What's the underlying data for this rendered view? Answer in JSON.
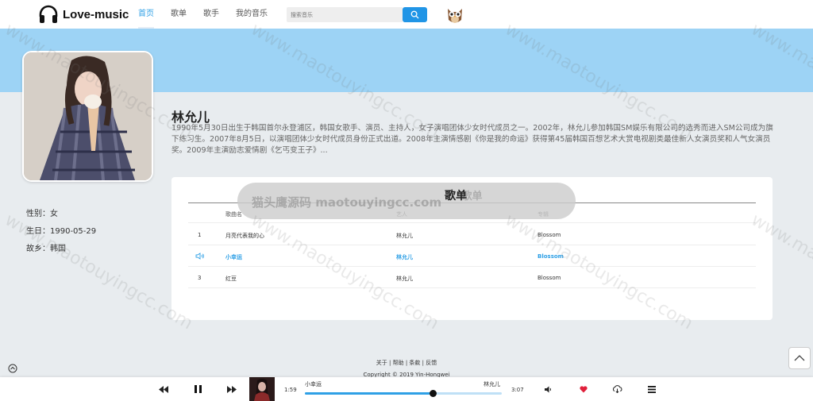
{
  "app": {
    "logo_text": "Love-music"
  },
  "nav": {
    "items": [
      "首页",
      "歌单",
      "歌手",
      "我的音乐"
    ],
    "active_index": 0
  },
  "search": {
    "placeholder": "搜索音乐"
  },
  "artist": {
    "name": "林允儿",
    "description": "1990年5月30日出生于韩国首尔永登浦区，韩国女歌手、演员、主持人，女子演唱团体少女时代成员之一。2002年，林允儿参加韩国SM娱乐有限公司的选秀而进入SM公司成为旗下练习生。2007年8月5日，以演唱团体少女时代成员身份正式出道。2008年主演情感剧《你是我的命运》获得第45届韩国百想艺术大赏电视剧类最佳新人女演员奖和人气女演员奖。2009年主演励志爱情剧《乞丐变王子》...",
    "gender": "性别：女",
    "birthday": "生日：1990-05-29",
    "hometown": "故乡：韩国"
  },
  "songlist": {
    "title": "歌单",
    "headers": {
      "name": "歌曲名",
      "artist": "艺人",
      "album": "专辑"
    },
    "rows": [
      {
        "index": "1",
        "name": "月亮代表我的心",
        "artist": "林允儿",
        "album": "Blossom"
      },
      {
        "index": "",
        "name": "小幸运",
        "artist": "林允儿",
        "album": "Blossom"
      },
      {
        "index": "3",
        "name": "红豆",
        "artist": "林允儿",
        "album": "Blossom"
      }
    ],
    "playing_row": 1
  },
  "overlay": {
    "text": "猫头鹰源码 maotouyingcc.com"
  },
  "footer": {
    "links": "关于 | 帮助 | 条款 | 反馈",
    "copyright": "Copyright © 2019 Yin-Hongwei"
  },
  "player": {
    "current_time": "1:59",
    "total_time": "3:07",
    "title": "小幸运",
    "artist": "林允儿",
    "progress": 0.65
  },
  "watermark": "www.maotouyingcc.com",
  "colors": {
    "accent": "#2fa0e6",
    "banner": "#9dd3f5",
    "like": "#e0203b"
  }
}
